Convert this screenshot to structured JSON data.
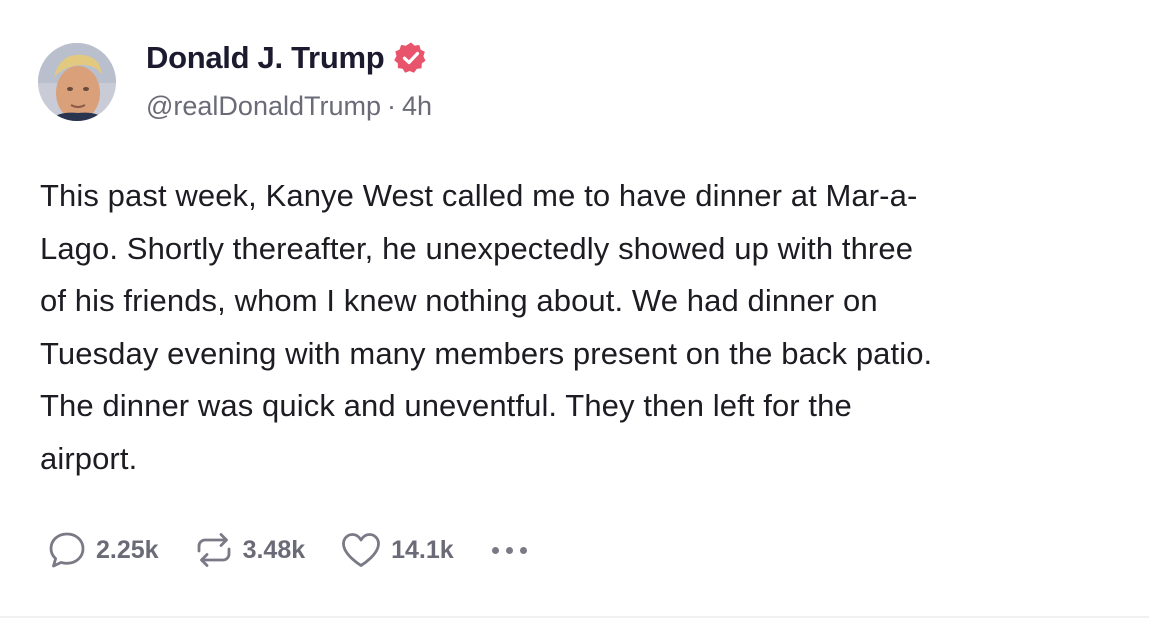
{
  "author": {
    "display_name": "Donald J. Trump",
    "verified_icon": "verified-badge-icon",
    "handle": "@realDonaldTrump",
    "separator": "·",
    "time_ago": "4h",
    "avatar_icon": "profile-avatar"
  },
  "post": {
    "lines": [
      "This past week, Kanye West called me to have dinner at Mar-a-",
      "Lago. Shortly thereafter, he unexpectedly showed up with three",
      "of his friends, whom I knew nothing about. We had dinner on",
      "Tuesday evening with many members present on the back patio.",
      "The dinner was quick and uneventful. They then left for the",
      "airport."
    ]
  },
  "actions": {
    "replies": {
      "icon": "reply-icon",
      "count": "2.25k"
    },
    "retruths": {
      "icon": "repost-icon",
      "count": "3.48k"
    },
    "likes": {
      "icon": "heart-icon",
      "count": "14.1k"
    },
    "more": {
      "icon": "more-dots-icon"
    }
  },
  "colors": {
    "verified_badge": "#e8546b",
    "name": "#1c1a2e",
    "muted": "#6b6b78",
    "body_text": "#1c1c22",
    "background": "#ffffff"
  }
}
